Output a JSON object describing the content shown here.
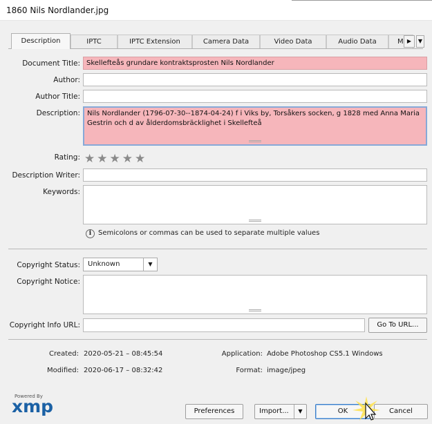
{
  "window": {
    "title": "1860 Nils Nordlander.jpg"
  },
  "tabs": [
    {
      "label": "Description",
      "active": true
    },
    {
      "label": "IPTC",
      "active": false
    },
    {
      "label": "IPTC Extension",
      "active": false
    },
    {
      "label": "Camera Data",
      "active": false
    },
    {
      "label": "Video Data",
      "active": false
    },
    {
      "label": "Audio Data",
      "active": false
    },
    {
      "label": "M",
      "active": false
    }
  ],
  "tab_scroll": {
    "next_icon": "▶",
    "menu_icon": "▼"
  },
  "fields": {
    "document_title": {
      "label": "Document Title:",
      "value": "Skellefteås grundare kontraktsprosten Nils Nordlander"
    },
    "author": {
      "label": "Author:",
      "value": ""
    },
    "author_title": {
      "label": "Author Title:",
      "value": ""
    },
    "description": {
      "label": "Description:",
      "value": "Nils Nordlander (1796-07-30--1874-04-24) f i Viks by, Torsåkers socken, g 1828 med Anna Maria Gestrin och d av ålderdomsbräcklighet i Skellefteå"
    },
    "rating": {
      "label": "Rating:",
      "stars": 0,
      "max": 5
    },
    "description_writer": {
      "label": "Description Writer:",
      "value": ""
    },
    "keywords": {
      "label": "Keywords:",
      "value": "",
      "hint": "Semicolons or commas can be used to separate multiple values"
    }
  },
  "copyright": {
    "status_label": "Copyright Status:",
    "status_value": "Unknown",
    "notice_label": "Copyright Notice:",
    "notice_value": "",
    "url_label": "Copyright Info URL:",
    "url_value": "",
    "goto_button": "Go To URL..."
  },
  "meta": {
    "created_label": "Created:",
    "created_value": "2020-05-21 – 08:45:54",
    "modified_label": "Modified:",
    "modified_value": "2020-06-17 – 08:32:42",
    "application_label": "Application:",
    "application_value": "Adobe Photoshop CS5.1 Windows",
    "format_label": "Format:",
    "format_value": "image/jpeg"
  },
  "footer": {
    "powered_by": "Powered By",
    "logo_text": "xmp",
    "preferences": "Preferences",
    "import": "Import...",
    "ok": "OK",
    "cancel": "Cancel"
  }
}
